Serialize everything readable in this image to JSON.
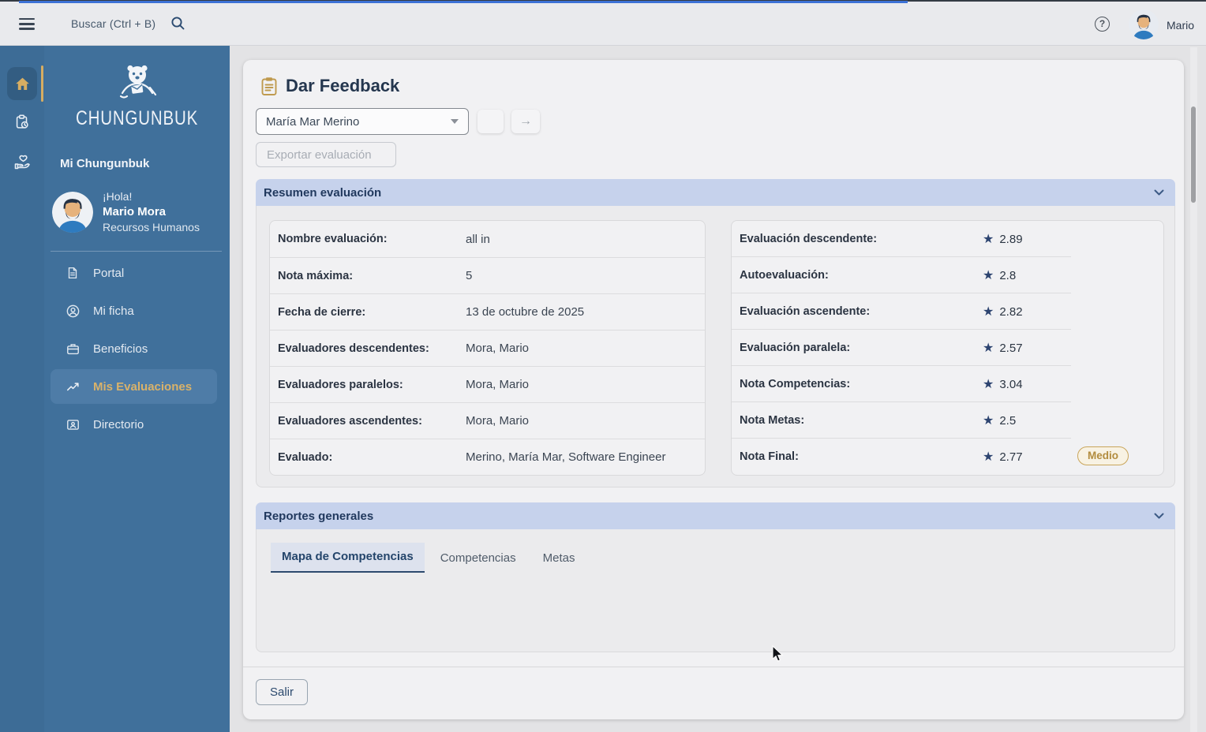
{
  "topbar": {
    "search_placeholder": "Buscar (Ctrl + B)",
    "username": "Mario"
  },
  "icons": {
    "question": "?",
    "arrow_right": "→",
    "star": "★"
  },
  "sidebar": {
    "brand": "CHUNGUNBUK",
    "section_title": "Mi Chungunbuk",
    "greeting": "¡Hola!",
    "user_name": "Mario Mora",
    "user_role": "Recursos Humanos",
    "items": [
      {
        "label": "Portal",
        "icon": "document-icon",
        "active": false
      },
      {
        "label": "Mi ficha",
        "icon": "person-icon",
        "active": false
      },
      {
        "label": "Beneficios",
        "icon": "briefcase-icon",
        "active": false
      },
      {
        "label": "Mis Evaluaciones",
        "icon": "trend-icon",
        "active": true
      },
      {
        "label": "Directorio",
        "icon": "id-card-icon",
        "active": false
      }
    ]
  },
  "main": {
    "title": "Dar Feedback",
    "employee_select": {
      "value": "María Mar Merino"
    },
    "export_label": "Exportar evaluación",
    "exit_label": "Salir",
    "summary": {
      "title": "Resumen evaluación",
      "details": [
        {
          "label": "Nombre evaluación:",
          "value": "all in"
        },
        {
          "label": "Nota máxima:",
          "value": "5"
        },
        {
          "label": "Fecha de cierre:",
          "value": "13 de octubre de 2025"
        },
        {
          "label": "Evaluadores descendentes:",
          "value": "Mora, Mario"
        },
        {
          "label": "Evaluadores paralelos:",
          "value": "Mora, Mario"
        },
        {
          "label": "Evaluadores ascendentes:",
          "value": "Mora, Mario"
        },
        {
          "label": "Evaluado:",
          "value": "Merino, María Mar, Software Engineer"
        }
      ],
      "scores": [
        {
          "label": "Evaluación descendente:",
          "value": "2.89"
        },
        {
          "label": "Autoevaluación:",
          "value": "2.8"
        },
        {
          "label": "Evaluación ascendente:",
          "value": "2.82"
        },
        {
          "label": "Evaluación paralela:",
          "value": "2.57"
        },
        {
          "label": "Nota Competencias:",
          "value": "3.04"
        },
        {
          "label": "Nota Metas:",
          "value": "2.5"
        },
        {
          "label": "Nota Final:",
          "value": "2.77",
          "badge": "Medio"
        }
      ]
    },
    "reports": {
      "title": "Reportes generales",
      "tabs": [
        {
          "label": "Mapa de Competencias",
          "active": true
        },
        {
          "label": "Competencias",
          "active": false
        },
        {
          "label": "Metas",
          "active": false
        }
      ]
    }
  },
  "colors": {
    "rail_blue": "#3d6c96",
    "sidebar_blue": "#40709b",
    "active_item_blue": "#4e7ca7",
    "gold_accent": "#d9b26a",
    "panel_header": "#c6d2ec",
    "star_navy": "#2d4470",
    "badge_gold": "#b28c3e",
    "progress_blue": "#3c71d6"
  }
}
